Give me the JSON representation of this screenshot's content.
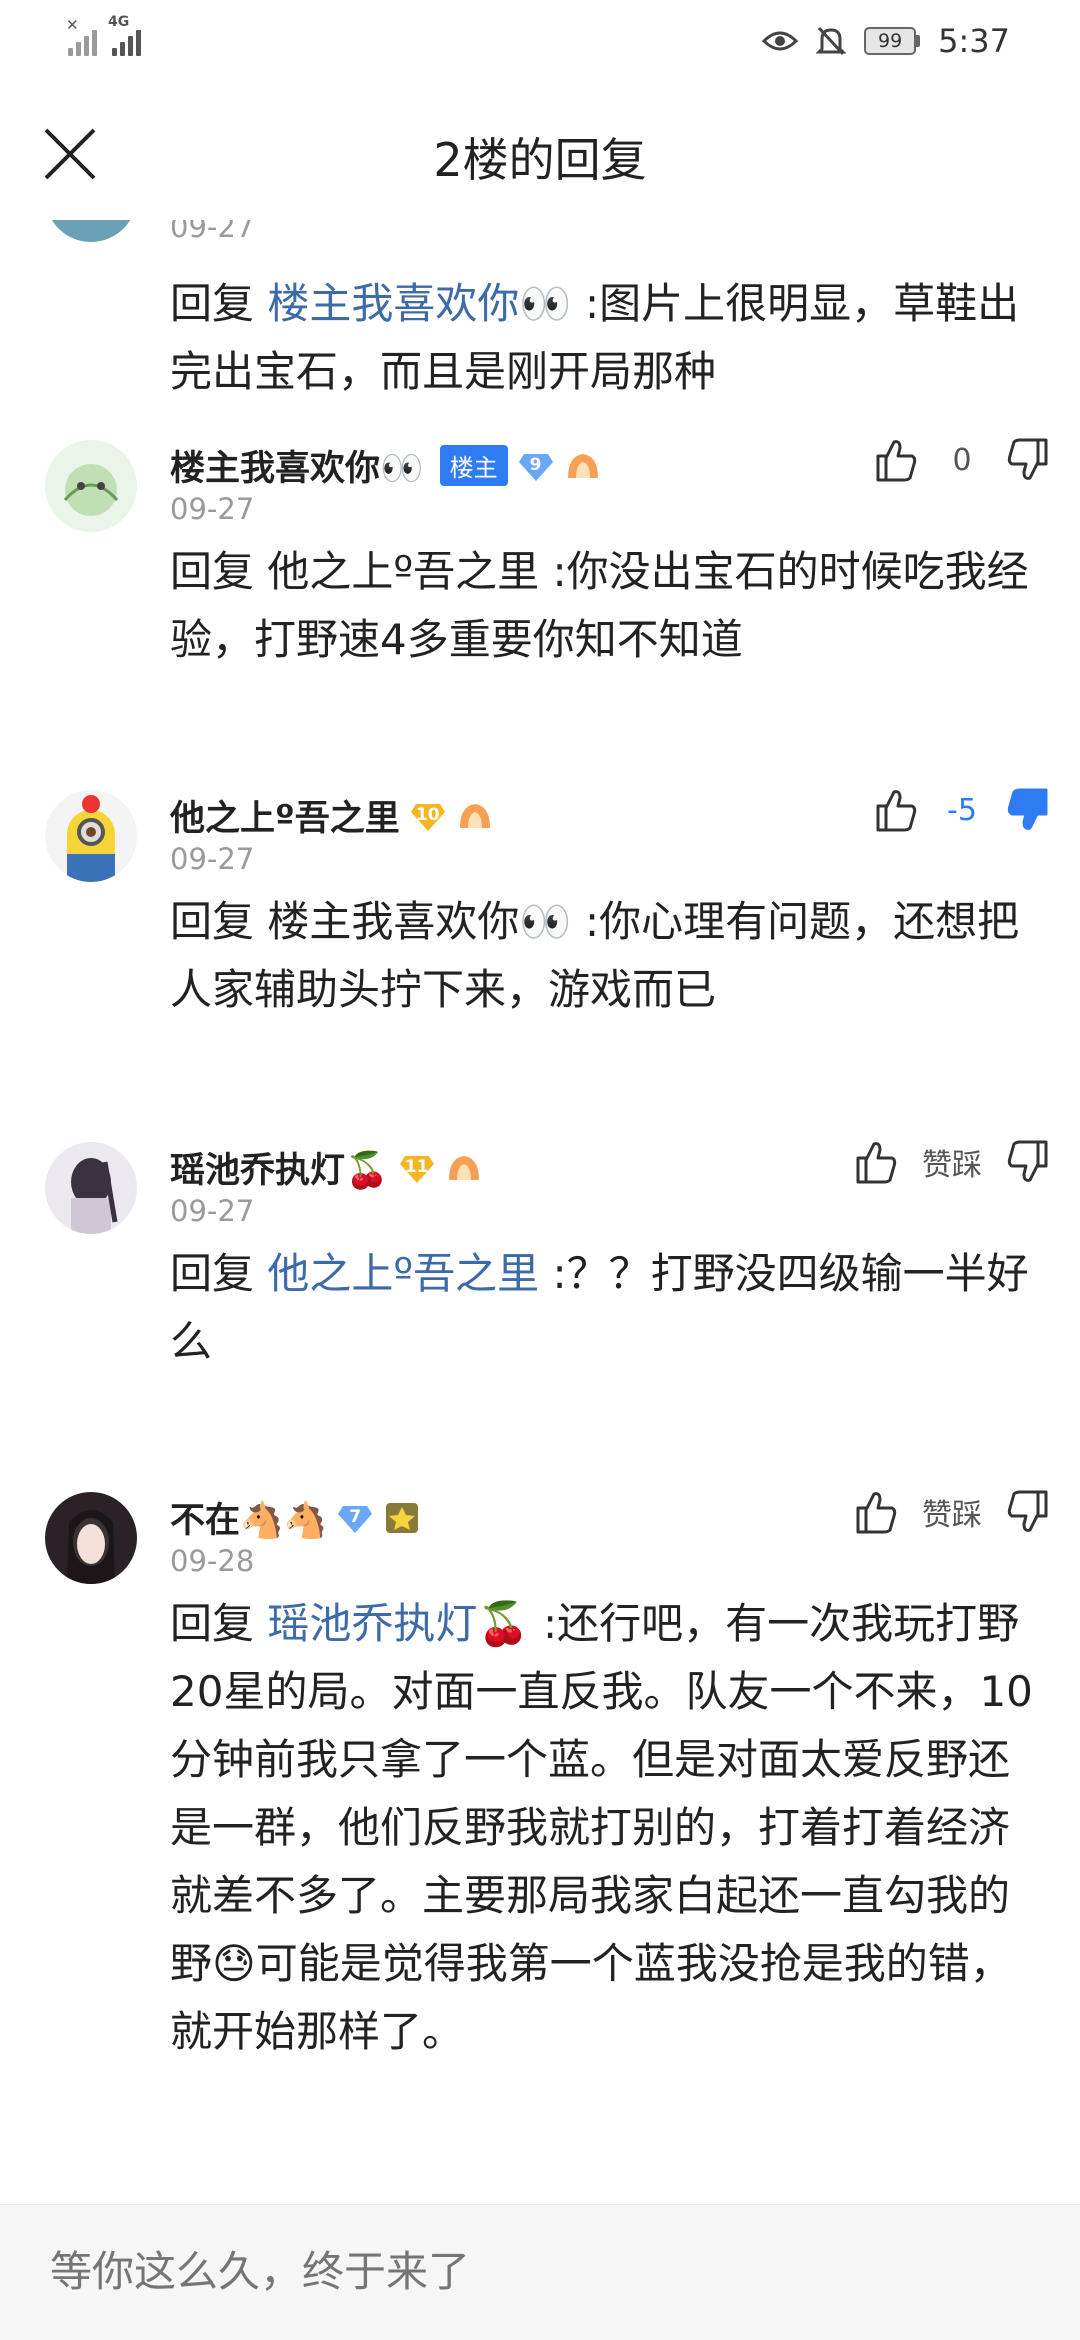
{
  "status_bar": {
    "time": "5:37",
    "battery": "99",
    "network": "4G"
  },
  "header": {
    "title": "2楼的回复"
  },
  "partial": {
    "date": "09-27",
    "reply": "回复",
    "mention": "楼主我喜欢你👀",
    "text": ":图片上很明显，草鞋出完出宝石，而且是刚开局那种"
  },
  "comments": [
    {
      "username": "楼主我喜欢你👀",
      "host_badge": "楼主",
      "level": "9",
      "date": "09-27",
      "reply": "回复",
      "mention": "他之上º吾之里",
      "text": ":你没出宝石的时候吃我经验，打野速4多重要你知不知道",
      "vote_count": "0"
    },
    {
      "username": "他之上º吾之里",
      "level": "10",
      "date": "09-27",
      "reply": "回复",
      "mention": "楼主我喜欢你👀",
      "text": ":你心理有问题，还想把人家辅助头拧下来，游戏而已",
      "vote_count": "-5"
    },
    {
      "username": "瑶池乔执灯🍒",
      "level": "11",
      "date": "09-27",
      "reply": "回复",
      "mention": "他之上º吾之里",
      "text": ":？？打野没四级输一半好么",
      "vote_count": "赞踩"
    },
    {
      "username": "不在🐴🐴",
      "level": "7",
      "date": "09-28",
      "reply": "回复",
      "mention": "瑶池乔执灯🍒",
      "text": ":还行吧，有一次我玩打野20星的局。对面一直反我。队友一个不来，10分钟前我只拿了一个蓝。但是对面太爱反野还是一群，他们反野我就打别的，打着打着经济就差不多了。主要那局我家白起还一直勾我的野😓可能是觉得我第一个蓝我没抢是我的错，就开始那样了。",
      "vote_count": "赞踩"
    }
  ],
  "input": {
    "placeholder": "等你这么久，终于来了"
  },
  "colors": {
    "mention": "#3d6aa8",
    "host_badge": "#2f7cf2",
    "thumb_down_active": "#2f7cf2",
    "gem_blue": "#6aa7f5",
    "gem_gold": "#f5b623"
  },
  "icons": {
    "close": "close-icon",
    "thumb_up": "thumb-up-icon",
    "thumb_down": "thumb-down-icon"
  }
}
